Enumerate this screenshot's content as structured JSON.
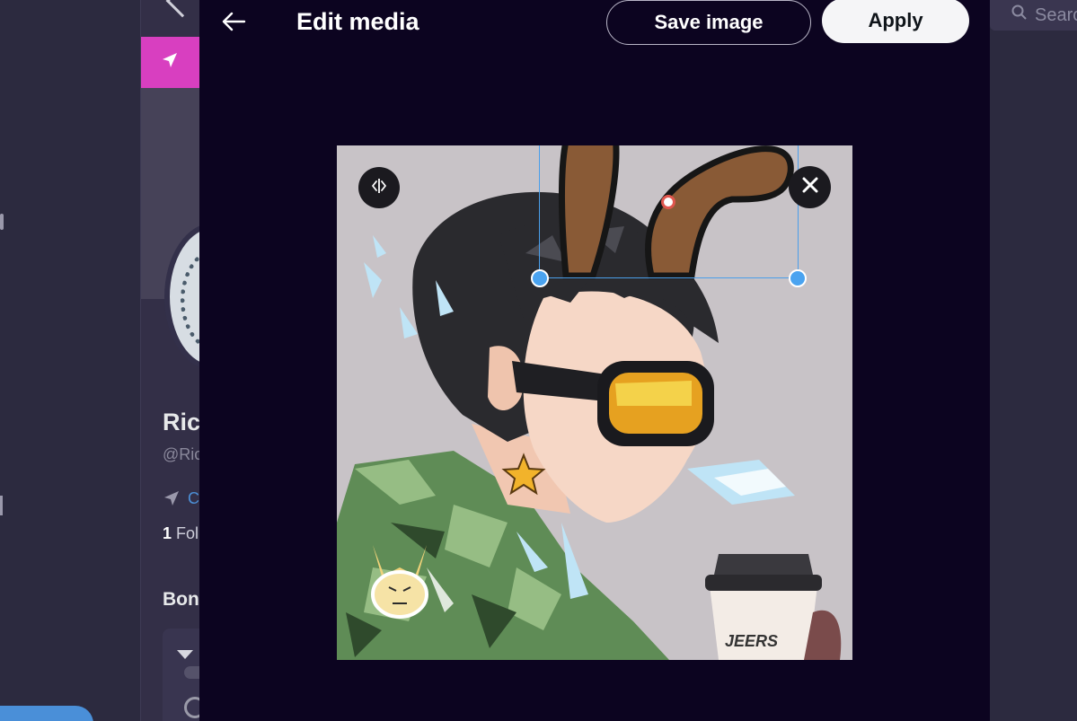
{
  "modal": {
    "title": "Edit media",
    "save_label": "Save image",
    "apply_label": "Apply"
  },
  "background": {
    "search_text": "Search",
    "name_text": "Ric",
    "handle_text": "@Ric",
    "link_text": "Co",
    "follow_count": "1",
    "follow_text": "Fol",
    "section_text": "Bon"
  },
  "image": {
    "cup_brand": "JEERS"
  },
  "colors": {
    "modal_bg": "#0c0420",
    "selection": "#4a9eea",
    "accent_pink": "#d83fc0"
  },
  "icons": {
    "back": "arrow-left-icon",
    "flip": "flip-horizontal-icon",
    "remove": "close-icon",
    "search": "search-icon",
    "send": "paper-plane-icon"
  }
}
